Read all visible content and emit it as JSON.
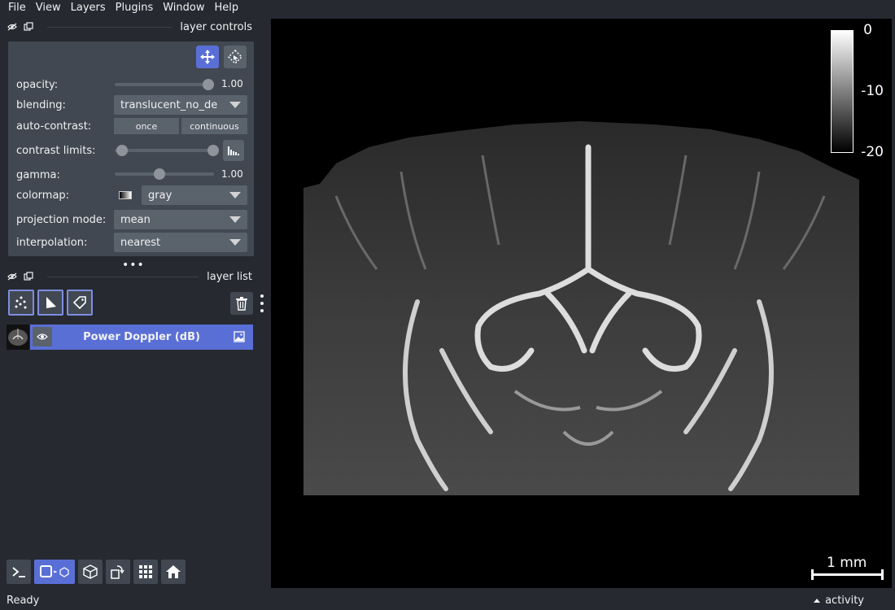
{
  "menu": [
    "File",
    "View",
    "Layers",
    "Plugins",
    "Window",
    "Help"
  ],
  "layer_controls": {
    "title": "layer controls",
    "opacity": {
      "label": "opacity:",
      "value": "1.00",
      "fraction": 1.0
    },
    "blending": {
      "label": "blending:",
      "value": "translucent_no_de"
    },
    "auto_contrast": {
      "label": "auto-contrast:",
      "once": "once",
      "continuous": "continuous"
    },
    "contrast_limits": {
      "label": "contrast limits:",
      "low_fraction": 0.0,
      "high_fraction": 1.0
    },
    "gamma": {
      "label": "gamma:",
      "value": "1.00",
      "fraction": 0.45
    },
    "colormap": {
      "label": "colormap:",
      "value": "gray"
    },
    "projection_mode": {
      "label": "projection mode:",
      "value": "mean"
    },
    "interpolation": {
      "label": "interpolation:",
      "value": "nearest"
    }
  },
  "layer_list": {
    "title": "layer list",
    "layers": [
      {
        "name": "Power Doppler (dB)",
        "visible": true
      }
    ]
  },
  "colorbar": {
    "ticks": [
      "0",
      "-10",
      "-20"
    ]
  },
  "scale_bar": {
    "label": "1 mm"
  },
  "status": {
    "text": "Ready",
    "activity": "activity"
  },
  "colors": {
    "accent": "#5a6fd6",
    "background": "#262930",
    "panel": "#414851"
  }
}
